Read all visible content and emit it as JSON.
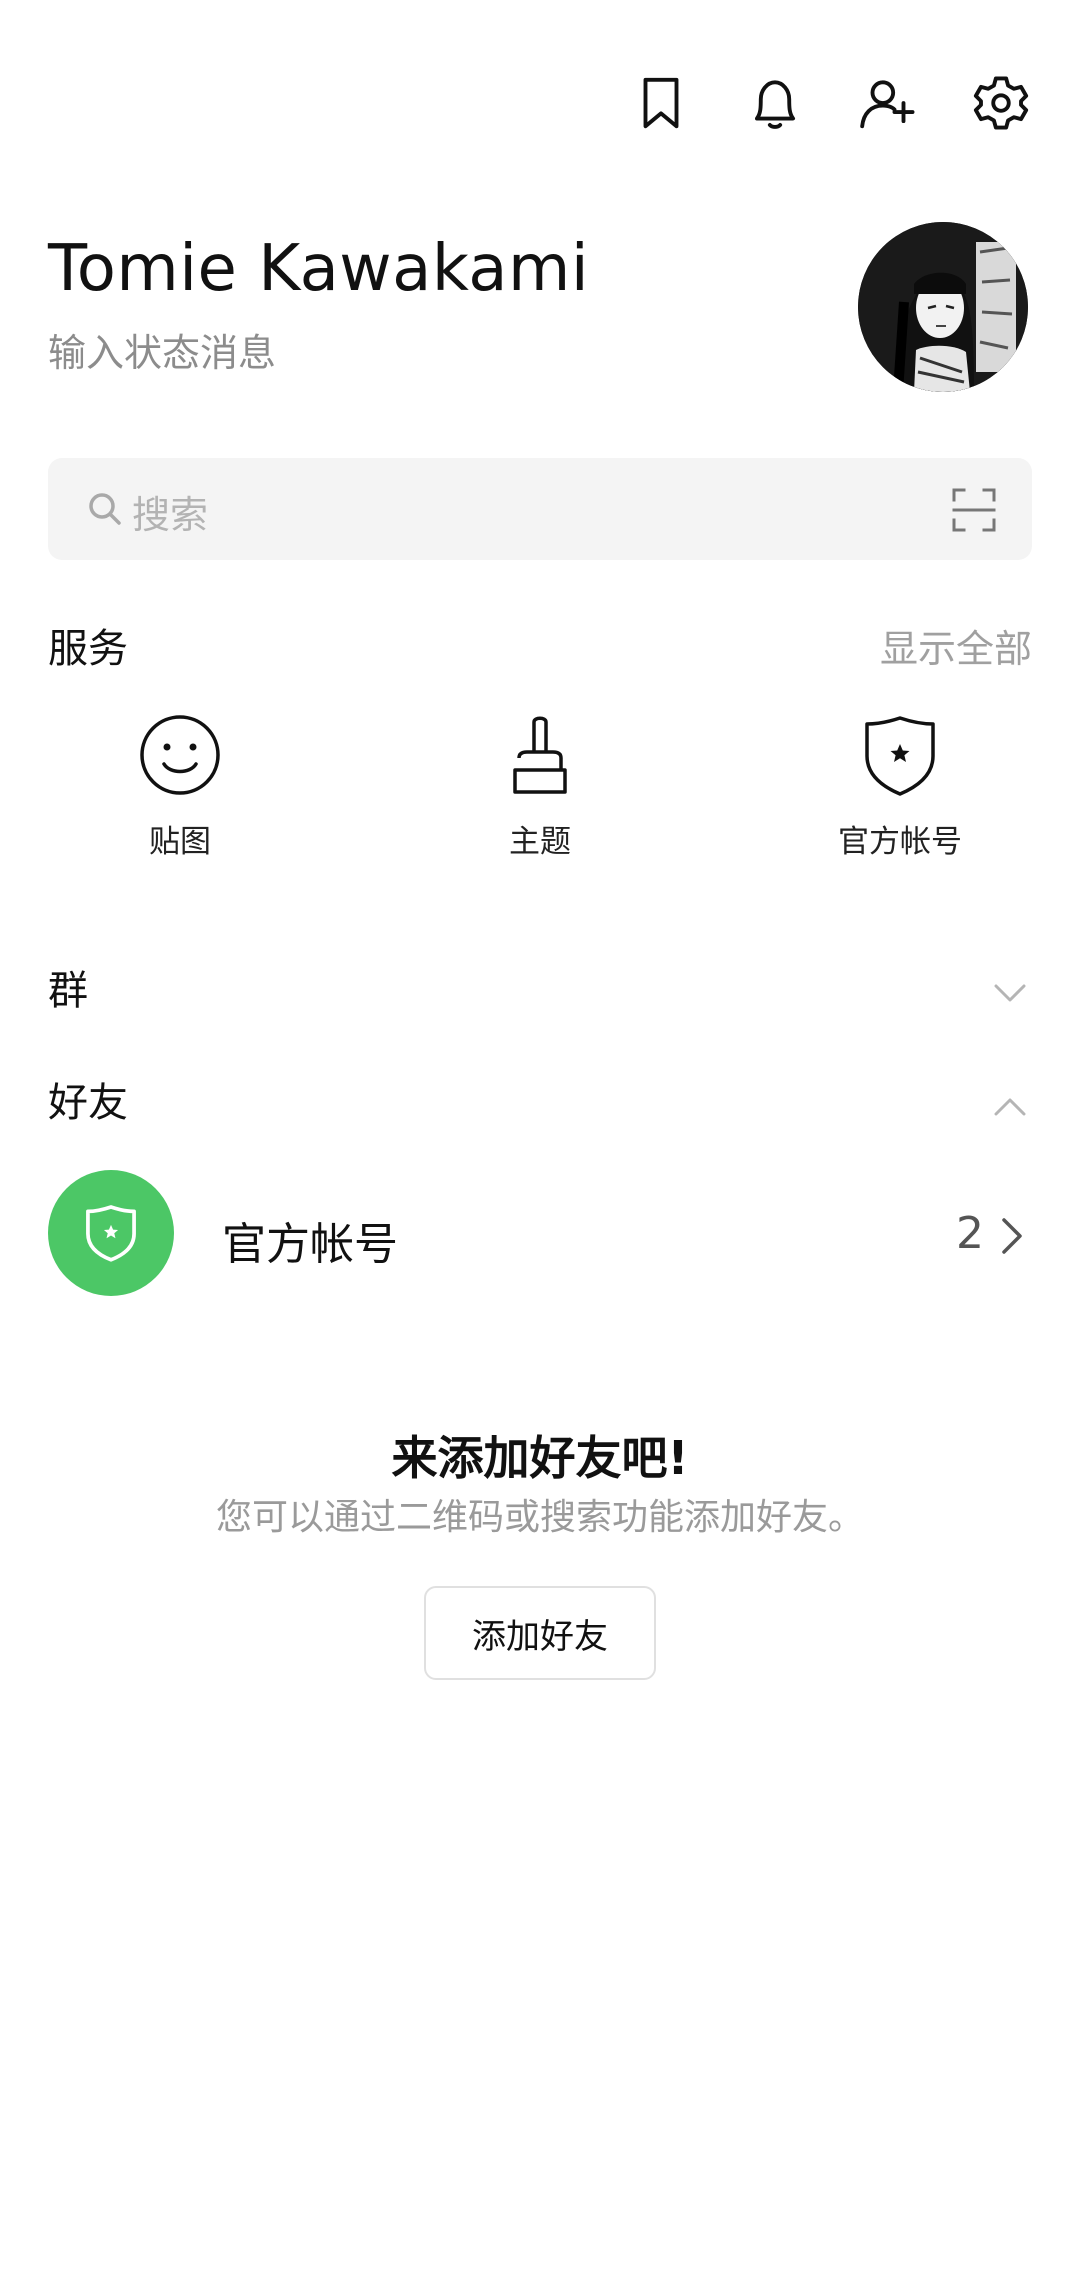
{
  "header": {
    "icons": [
      "bookmark-icon",
      "bell-icon",
      "add-friend-icon",
      "gear-icon"
    ]
  },
  "profile": {
    "name": "Tomie Kawakami",
    "status_placeholder": "输入状态消息"
  },
  "search": {
    "placeholder": "搜索"
  },
  "services": {
    "title": "服务",
    "show_all": "显示全部",
    "items": [
      {
        "label": "贴图",
        "icon": "smiley-icon"
      },
      {
        "label": "主题",
        "icon": "brush-icon"
      },
      {
        "label": "官方帐号",
        "icon": "shield-star-icon"
      }
    ]
  },
  "groups": {
    "title": "群"
  },
  "friends": {
    "title": "好友",
    "official_accounts": {
      "label": "官方帐号",
      "count": "2"
    }
  },
  "empty_state": {
    "title": "来添加好友吧!",
    "description": "您可以通过二维码或搜索功能添加好友。",
    "button_label": "添加好友"
  },
  "colors": {
    "accent_green": "#4cc766",
    "muted_text": "#8c8c8c",
    "search_bg": "#f4f4f4"
  }
}
